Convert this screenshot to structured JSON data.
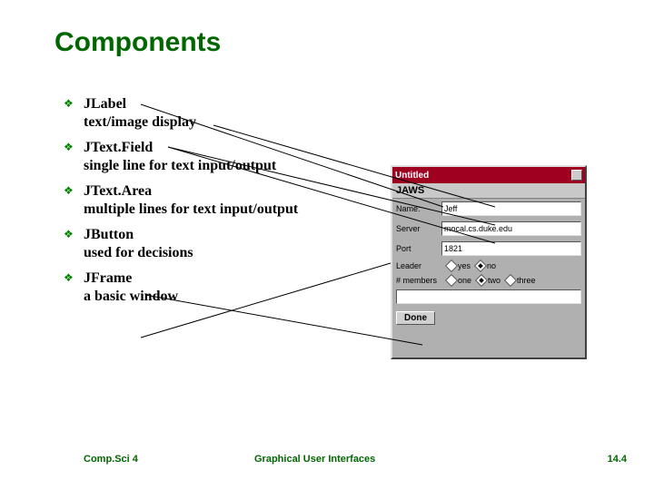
{
  "title": "Components",
  "bullets": [
    {
      "head": "JLabel",
      "desc": "text/image display"
    },
    {
      "head": "JText.Field",
      "desc": "single line for text input/output"
    },
    {
      "head": "JText.Area",
      "desc": "multiple lines for text input/output"
    },
    {
      "head": "JButton",
      "desc": "used for decisions"
    },
    {
      "head": "JFrame",
      "desc": "a basic window"
    }
  ],
  "jaws": {
    "title": "Untitled",
    "header": "JAWS",
    "rows": [
      {
        "label": "Name:",
        "value": "Jeff"
      },
      {
        "label": "Server",
        "value": "mocal.cs.duke.edu"
      },
      {
        "label": "Port",
        "value": "1821"
      }
    ],
    "leader": {
      "label": "Leader",
      "options": [
        {
          "label": "yes",
          "checked": false
        },
        {
          "label": "no",
          "checked": true
        }
      ]
    },
    "members": {
      "label": "# members",
      "options": [
        {
          "label": "one",
          "checked": false
        },
        {
          "label": "two",
          "checked": true
        },
        {
          "label": "three",
          "checked": false
        }
      ]
    },
    "done": "Done"
  },
  "footer": {
    "left": "Comp.Sci 4",
    "center": "Graphical User Interfaces",
    "right": "14.4"
  }
}
